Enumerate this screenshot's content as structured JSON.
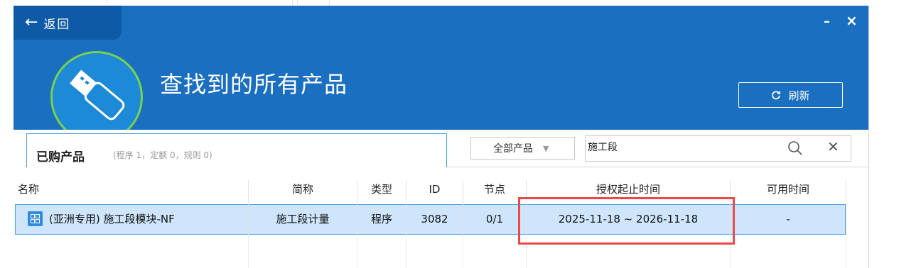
{
  "window": {
    "back_label": "返回",
    "minimize": "–",
    "close": "×",
    "title": "查找到的所有产品",
    "refresh_label": "刷新",
    "colors": {
      "header": "#1a6fc0",
      "back": "#0f5aa6",
      "logo_ring": "#7ad14d",
      "accent": "#4aa0e6",
      "highlight_box": "#e84a4a",
      "row_selected": "#cfe5fb"
    }
  },
  "tabs": {
    "purchased_label": "已购产品",
    "purchased_sub": "(程序 1，定额 0，规则 0)"
  },
  "filter": {
    "selected": "全部产品"
  },
  "search": {
    "value": "施工段"
  },
  "table": {
    "columns": [
      "名称",
      "简称",
      "类型",
      "ID",
      "节点",
      "授权起止时间",
      "可用时间"
    ],
    "rows": [
      {
        "icon": "grid-app-icon",
        "name": "(亚洲专用) 施工段模块-NF",
        "short": "施工段计量",
        "type": "程序",
        "id": "3082",
        "nodes": "0/1",
        "period": "2025-11-18 ~ 2026-11-18",
        "available": "-"
      }
    ]
  }
}
